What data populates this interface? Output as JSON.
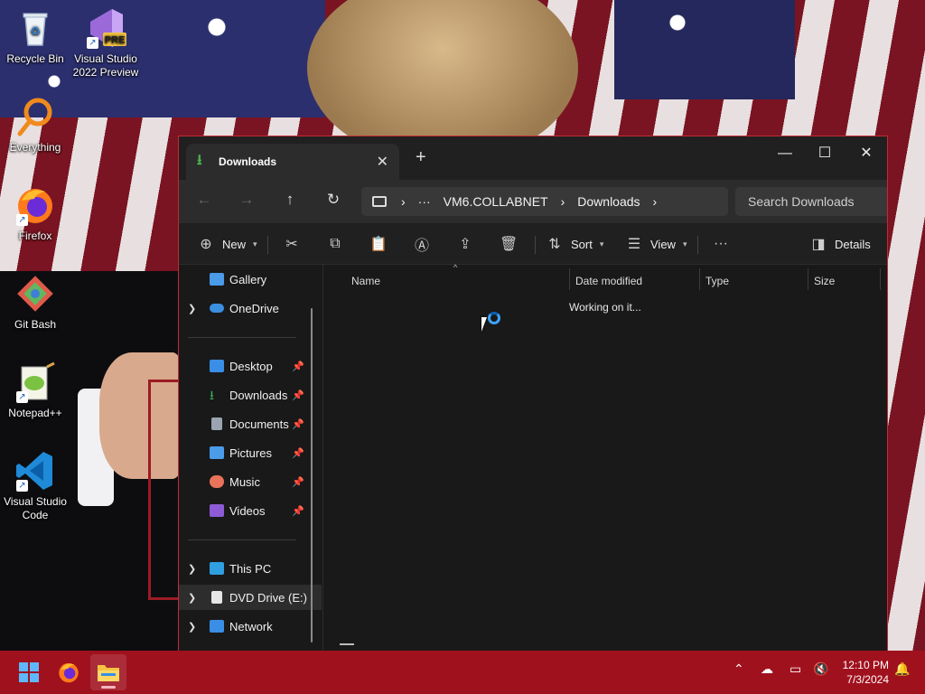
{
  "desktop": {
    "icons": [
      {
        "label": "Recycle Bin",
        "icon": "recycle-bin-icon"
      },
      {
        "label": "Visual Studio 2022 Preview",
        "badge": "PRE",
        "icon": "visual-studio-icon"
      },
      {
        "label": "Everything",
        "icon": "everything-search-icon"
      },
      {
        "label": "Firefox",
        "icon": "firefox-icon"
      },
      {
        "label": "Git Bash",
        "icon": "git-bash-icon"
      },
      {
        "label": "Notepad++",
        "icon": "notepad-plus-plus-icon"
      },
      {
        "label": "Visual Studio Code",
        "icon": "vscode-icon"
      }
    ]
  },
  "window": {
    "tab_title": "Downloads",
    "new_tab_glyph": "+",
    "controls": {
      "minimize": "—",
      "maximize": "☐",
      "close": "✕"
    },
    "nav": {
      "back": "←",
      "forward": "→",
      "up": "↑",
      "refresh": "↻"
    },
    "breadcrumb": {
      "more": "···",
      "host": "VM6.COLLABNET",
      "folder": "Downloads"
    },
    "search_placeholder": "Search Downloads",
    "command_bar": {
      "new": "New",
      "sort": "Sort",
      "view": "View",
      "more": "···",
      "details": "Details"
    },
    "nav_pane": {
      "gallery": "Gallery",
      "onedrive": "OneDrive",
      "quick_access": [
        {
          "label": "Desktop",
          "color": "#3a8ee6"
        },
        {
          "label": "Downloads",
          "color": "#3fae5a"
        },
        {
          "label": "Documents",
          "color": "#9aa5b1"
        },
        {
          "label": "Pictures",
          "color": "#4a9be8"
        },
        {
          "label": "Music",
          "color": "#e8735a"
        },
        {
          "label": "Videos",
          "color": "#8d5bd6"
        }
      ],
      "this_pc": "This PC",
      "dvd_drive": "DVD Drive (E:) vi",
      "network": "Network"
    },
    "columns": {
      "name": "Name",
      "date_modified": "Date modified",
      "type": "Type",
      "size": "Size"
    },
    "status_text": "Working on it..."
  },
  "taskbar": {
    "clock_time": "12:10 PM",
    "clock_date": "7/3/2024"
  }
}
